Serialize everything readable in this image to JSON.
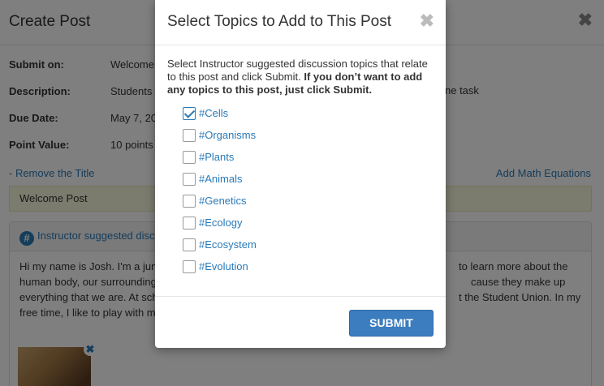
{
  "background": {
    "title": "Create Post",
    "close_glyph": "✖",
    "fields": [
      {
        "label": "Submit on:",
        "value": "Welcome"
      },
      {
        "label": "Description:",
        "value": "Students"
      },
      {
        "label": "Due Date:",
        "value": "May 7, 20"
      },
      {
        "label": "Point Value:",
        "value": "10 points"
      }
    ],
    "description_tail": "ne task",
    "remove_title_link": "- Remove the Title",
    "add_math_link": "Add Math Equations",
    "title_value": "Welcome Post",
    "panel": {
      "icon": "hashtag-icon",
      "icon_glyph": "#",
      "heading": "Instructor suggested discu",
      "body_left": [
        "Hi my name is Josh. I'm a juni",
        "human body, our surrounding",
        "everything that we are. At sch",
        "free time, I like to play with m"
      ],
      "body_right": [
        "to learn more about the",
        "cause they make up",
        "t the Student Union. In my",
        ""
      ],
      "thumbnail_remove_glyph": "✖"
    }
  },
  "modal": {
    "title": "Select Topics to Add to This Post",
    "close_glyph": "✖",
    "description_plain": "Select Instructor suggested discussion topics that relate to this post and click Submit.",
    "description_bold": "If you don’t want to add any topics to this post, just click Submit.",
    "topics": [
      {
        "label": "#Cells",
        "checked": true
      },
      {
        "label": "#Organisms",
        "checked": false
      },
      {
        "label": "#Plants",
        "checked": false
      },
      {
        "label": "#Animals",
        "checked": false
      },
      {
        "label": "#Genetics",
        "checked": false
      },
      {
        "label": "#Ecology",
        "checked": false
      },
      {
        "label": "#Ecosystem",
        "checked": false
      },
      {
        "label": "#Evolution",
        "checked": false
      }
    ],
    "submit_label": "SUBMIT"
  },
  "colors": {
    "accent": "#2a7ab8",
    "button": "#3c7dbf",
    "title_box": "#f7f7dc"
  }
}
